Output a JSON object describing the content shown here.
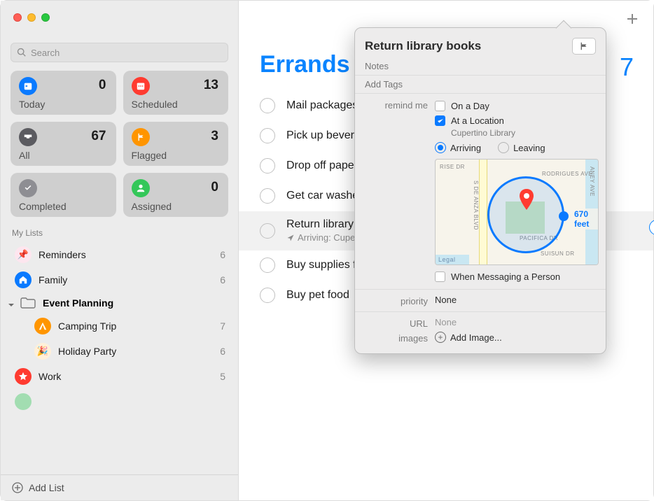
{
  "search": {
    "placeholder": "Search"
  },
  "cards": [
    {
      "label": "Today",
      "count": "0"
    },
    {
      "label": "Scheduled",
      "count": "13"
    },
    {
      "label": "All",
      "count": "67"
    },
    {
      "label": "Flagged",
      "count": "3"
    },
    {
      "label": "Completed",
      "count": ""
    },
    {
      "label": "Assigned",
      "count": "0"
    }
  ],
  "sidebar": {
    "section": "My Lists",
    "items": [
      {
        "name": "Reminders",
        "count": "6"
      },
      {
        "name": "Family",
        "count": "6"
      },
      {
        "name": "Event Planning",
        "count": ""
      },
      {
        "name": "Camping Trip",
        "count": "7"
      },
      {
        "name": "Holiday Party",
        "count": "6"
      },
      {
        "name": "Work",
        "count": "5"
      }
    ],
    "add": "Add List"
  },
  "main": {
    "title": "Errands",
    "count": "7",
    "todos": [
      {
        "title": "Mail packages"
      },
      {
        "title": "Pick up beverages"
      },
      {
        "title": "Drop off paperwork"
      },
      {
        "title": "Get car washed"
      },
      {
        "title": "Return library books",
        "sub": "Arriving: Cupertino Library"
      },
      {
        "title": "Buy supplies for trip"
      },
      {
        "title": "Buy pet food"
      }
    ]
  },
  "popover": {
    "title": "Return library books",
    "notes_placeholder": "Notes",
    "tags_placeholder": "Add Tags",
    "remind_label": "remind me",
    "on_day": "On a Day",
    "at_location": "At a Location",
    "location_name": "Cupertino Library",
    "arriving": "Arriving",
    "leaving": "Leaving",
    "when_messaging": "When Messaging a Person",
    "priority_label": "priority",
    "priority_value": "None",
    "url_label": "URL",
    "url_value": "None",
    "images_label": "images",
    "add_image": "Add Image...",
    "distance": "670 feet",
    "map_labels": {
      "rise": "RISE DR",
      "deanza": "S DE ANZA BLVD",
      "rodrigues": "RODRIGUES AVE",
      "pacifica": "PACIFICA DR",
      "suisun": "SUISUN DR",
      "aney": "ANEY AVE",
      "legal": "Legal"
    }
  }
}
